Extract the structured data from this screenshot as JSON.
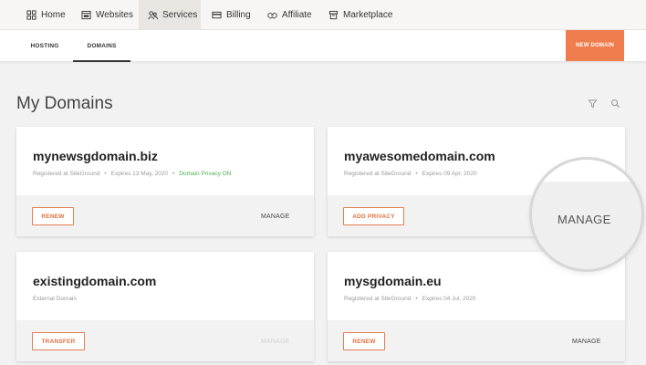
{
  "nav": {
    "items": [
      {
        "label": "Home",
        "icon": "grid-icon"
      },
      {
        "label": "Websites",
        "icon": "browser-icon"
      },
      {
        "label": "Services",
        "icon": "people-icon",
        "active": true
      },
      {
        "label": "Billing",
        "icon": "card-icon"
      },
      {
        "label": "Affiliate",
        "icon": "handshake-icon"
      },
      {
        "label": "Marketplace",
        "icon": "box-icon"
      }
    ]
  },
  "subnav": {
    "tabs": [
      {
        "label": "HOSTING"
      },
      {
        "label": "DOMAINS",
        "active": true
      }
    ],
    "new_domain": "NEW DOMAIN"
  },
  "page": {
    "title": "My Domains"
  },
  "domains": [
    {
      "name": "mynewsgdomain.biz",
      "registrar": "Registered at SiteGround",
      "expires": "Expires 13 May, 2020",
      "privacy": "Domain Privacy ON",
      "action": "RENEW",
      "manage": "MANAGE"
    },
    {
      "name": "myawesomedomain.com",
      "registrar": "Registered at SiteGround",
      "expires": "Expires 09 Apr, 2020",
      "action": "ADD PRIVACY",
      "manage": "MANAGE"
    },
    {
      "name": "existingdomain.com",
      "registrar": "External Domain",
      "action": "TRANSFER",
      "manage": "MANAGE"
    },
    {
      "name": "mysgdomain.eu",
      "registrar": "Registered at SiteGround",
      "expires": "Expires 04 Jul, 2020",
      "action": "RENEW",
      "manage": "MANAGE"
    }
  ],
  "magnifier": {
    "label": "MANAGE"
  },
  "colors": {
    "accent": "#ef7d4d",
    "green": "#4caf50"
  }
}
